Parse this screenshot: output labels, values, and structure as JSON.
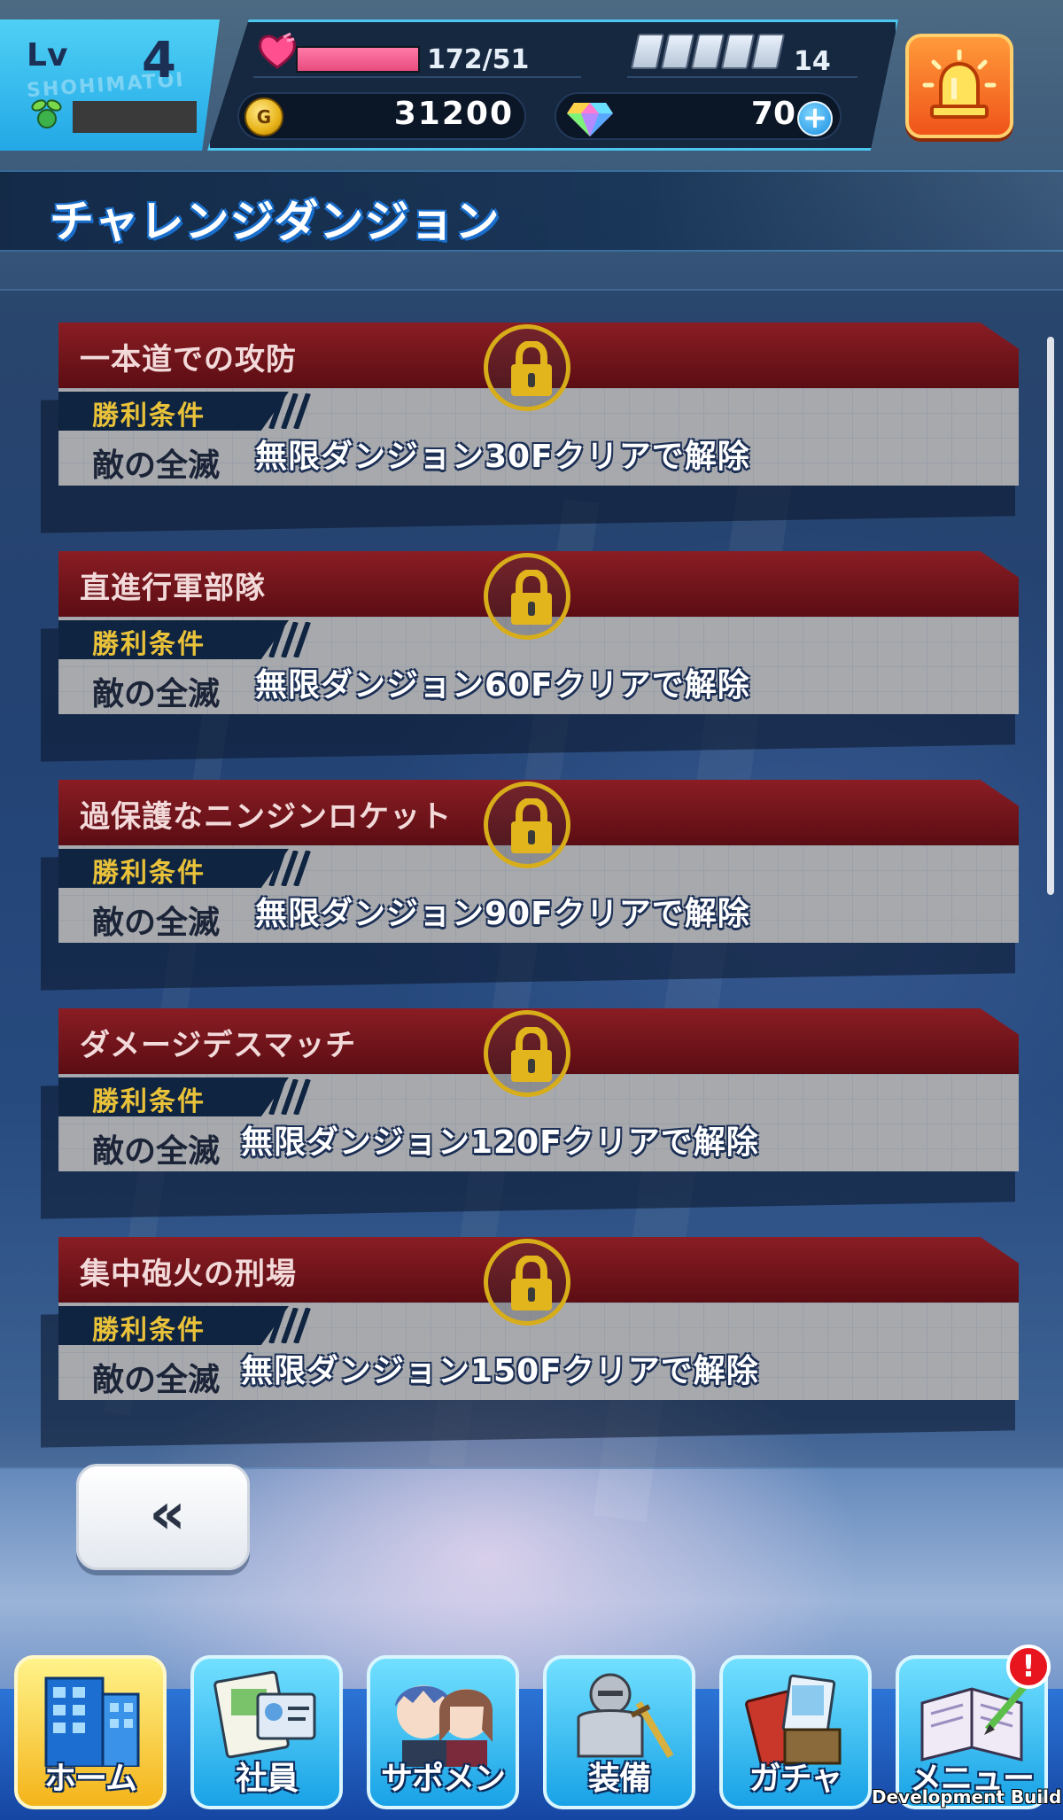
{
  "player": {
    "level_label": "Lv",
    "level": "4",
    "hp_text": "172/51",
    "hp_fill": 1.0,
    "tickets": "14",
    "gold": "31200",
    "gems": "70",
    "watermark": "SHOHIMATOI"
  },
  "header": {
    "title": "チャレンジダンジョン"
  },
  "dungeons": [
    {
      "name": "一本道での攻防",
      "condition_label": "勝利条件",
      "condition": "敵の全滅",
      "unlock": "無限ダンジョン30Fクリアで解除",
      "locked": true
    },
    {
      "name": "直進行軍部隊",
      "condition_label": "勝利条件",
      "condition": "敵の全滅",
      "unlock": "無限ダンジョン60Fクリアで解除",
      "locked": true
    },
    {
      "name": "過保護なニンジンロケット",
      "condition_label": "勝利条件",
      "condition": "敵の全滅",
      "unlock": "無限ダンジョン90Fクリアで解除",
      "locked": true
    },
    {
      "name": "ダメージデスマッチ",
      "condition_label": "勝利条件",
      "condition": "敵の全滅",
      "unlock": "無限ダンジョン120Fクリアで解除",
      "locked": true
    },
    {
      "name": "集中砲火の刑場",
      "condition_label": "勝利条件",
      "condition": "敵の全滅",
      "unlock": "無限ダンジョン150Fクリアで解除",
      "locked": true
    }
  ],
  "back_button": {
    "label": "«"
  },
  "nav": [
    {
      "label": "ホーム",
      "icon": "building-icon",
      "active": true
    },
    {
      "label": "社員",
      "icon": "employee-cards-icon",
      "active": false
    },
    {
      "label": "サポメン",
      "icon": "support-members-icon",
      "active": false
    },
    {
      "label": "装備",
      "icon": "armor-icon",
      "active": false
    },
    {
      "label": "ガチャ",
      "icon": "gacha-icon",
      "active": false
    },
    {
      "label": "メニュー",
      "icon": "notebook-icon",
      "active": false,
      "badge": "!"
    }
  ],
  "footer": {
    "dev_build": "Development Build"
  },
  "colors": {
    "accent": "#23a8e6",
    "card_header": "#7a1820",
    "lock_ring": "#d8ad1a",
    "condition_label": "#e9c23a"
  }
}
